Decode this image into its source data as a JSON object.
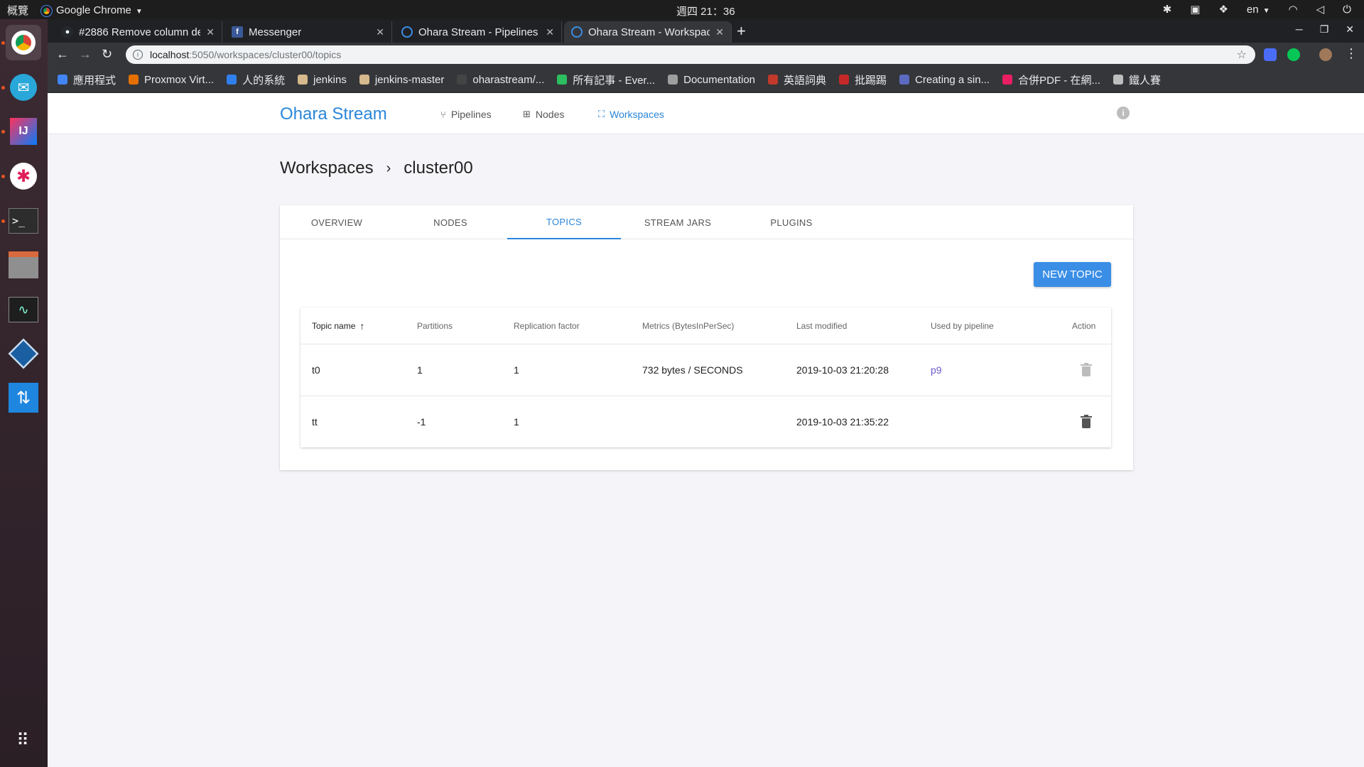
{
  "os": {
    "activities": "概覽",
    "app_name": "Google Chrome",
    "clock": "週四 21：36",
    "keyboard_lang": "en"
  },
  "browser": {
    "tabs": [
      {
        "title": "#2886 Remove column de",
        "favicon": "github-icon"
      },
      {
        "title": "Messenger",
        "favicon": "facebook-icon"
      },
      {
        "title": "Ohara Stream - Pipelines",
        "favicon": "ohara-icon"
      },
      {
        "title": "Ohara Stream - Workspac",
        "favicon": "ohara-icon",
        "active": true
      }
    ],
    "url_host": "localhost",
    "url_path": ":5050/workspaces/cluster00/topics",
    "bookmarks": [
      {
        "label": "應用程式",
        "color": "#4285f4"
      },
      {
        "label": "Proxmox Virt...",
        "color": "#e57000"
      },
      {
        "label": "人的系統",
        "color": "#2f80ed"
      },
      {
        "label": "jenkins",
        "color": "#d6b98c"
      },
      {
        "label": "jenkins-master",
        "color": "#d6b98c"
      },
      {
        "label": "oharastream/...",
        "color": "#444444"
      },
      {
        "label": "所有記事 - Ever...",
        "color": "#2dbe60"
      },
      {
        "label": "Documentation",
        "color": "#9e9e9e"
      },
      {
        "label": "英語詞典",
        "color": "#c0392b"
      },
      {
        "label": "批踢踢",
        "color": "#c62828"
      },
      {
        "label": "Creating a sin...",
        "color": "#5c6bc0"
      },
      {
        "label": "合併PDF - 在網...",
        "color": "#e91e63"
      },
      {
        "label": "鐵人賽",
        "color": "#bdbdbd"
      }
    ]
  },
  "app": {
    "brand": "Ohara Stream",
    "nav": [
      {
        "label": "Pipelines",
        "icon": "branch-icon"
      },
      {
        "label": "Nodes",
        "icon": "sitemap-icon"
      },
      {
        "label": "Workspaces",
        "icon": "network-icon",
        "active": true
      }
    ],
    "breadcrumb": {
      "root": "Workspaces",
      "current": "cluster00"
    },
    "tabs": [
      "OVERVIEW",
      "NODES",
      "TOPICS",
      "STREAM JARS",
      "PLUGINS"
    ],
    "active_tab": "TOPICS",
    "new_topic_label": "NEW TOPIC",
    "table": {
      "columns": [
        "Topic name",
        "Partitions",
        "Replication factor",
        "Metrics (BytesInPerSec)",
        "Last modified",
        "Used by pipeline",
        "Action"
      ],
      "rows": [
        {
          "name": "t0",
          "partitions": "1",
          "replication": "1",
          "metrics": "732 bytes / SECONDS",
          "modified": "2019-10-03 21:20:28",
          "pipeline": "p9",
          "delete_enabled": false
        },
        {
          "name": "tt",
          "partitions": "-1",
          "replication": "1",
          "metrics": "",
          "modified": "2019-10-03 21:35:22",
          "pipeline": "",
          "delete_enabled": true
        }
      ]
    }
  }
}
